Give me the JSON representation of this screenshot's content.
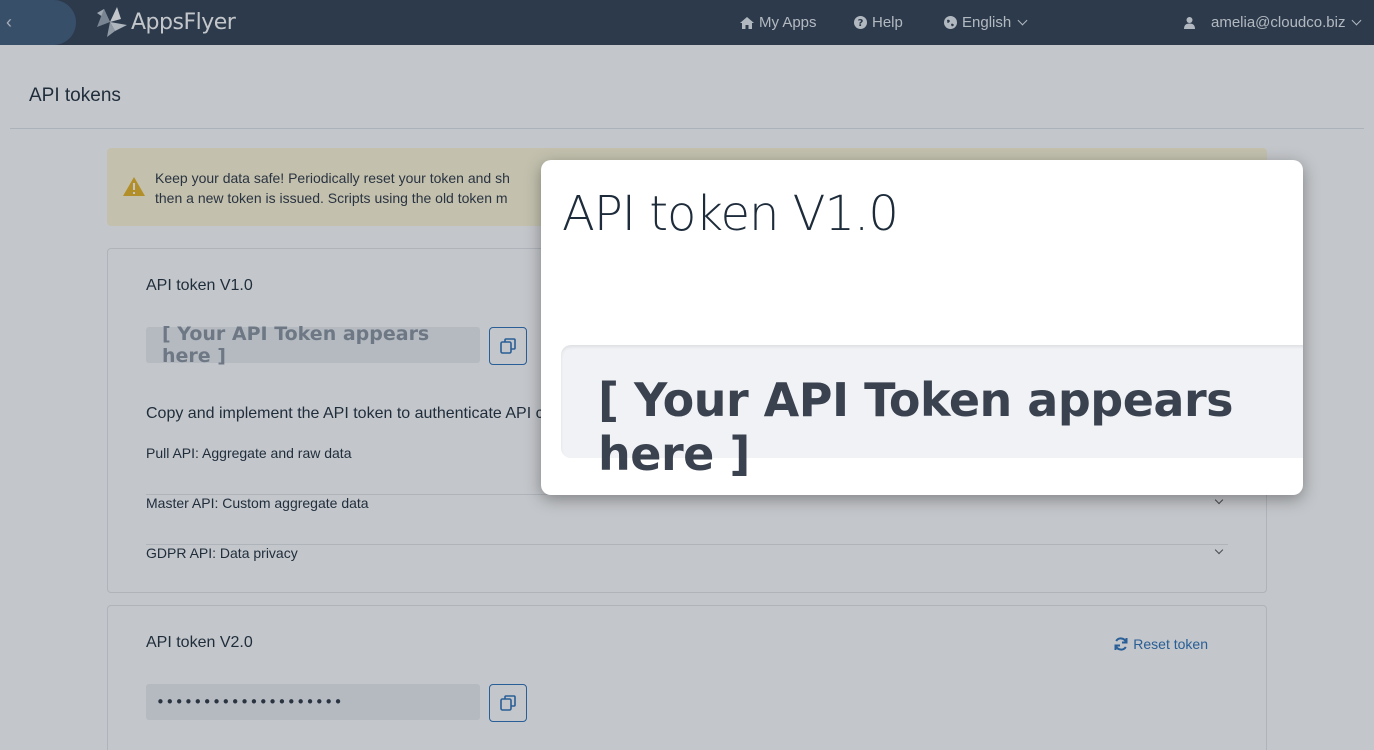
{
  "nav": {
    "back_glyph": "‹",
    "brand": "AppsFlyer",
    "my_apps": "My Apps",
    "help": "Help",
    "language": "English",
    "user": "amelia@cloudco.biz"
  },
  "page": {
    "title": "API tokens"
  },
  "alert": {
    "line1": "Keep your data safe! Periodically reset your token and sh",
    "line2": "then a new token is issued. Scripts using the old token m"
  },
  "token_v1": {
    "title": "API token V1.0",
    "placeholder": "[ Your API Token appears here ]",
    "description": "Copy and implement the API token to authenticate API c",
    "api_rows": [
      {
        "label": "Pull API: Aggregate and raw data"
      },
      {
        "label": "Master API: Custom aggregate data"
      },
      {
        "label": "GDPR API: Data privacy"
      }
    ]
  },
  "token_v2": {
    "title": "API token V2.0",
    "reset_label": "Reset token",
    "masked_value": "••••••••••••••••••••"
  },
  "zoom": {
    "title": "API token V1.0",
    "token_text": "[ Your API Token appears here ]"
  },
  "colors": {
    "topbar": "#2e3e50",
    "link": "#2a6fb8",
    "alert_bg": "#fff9d9",
    "warning_icon": "#e8b320"
  }
}
